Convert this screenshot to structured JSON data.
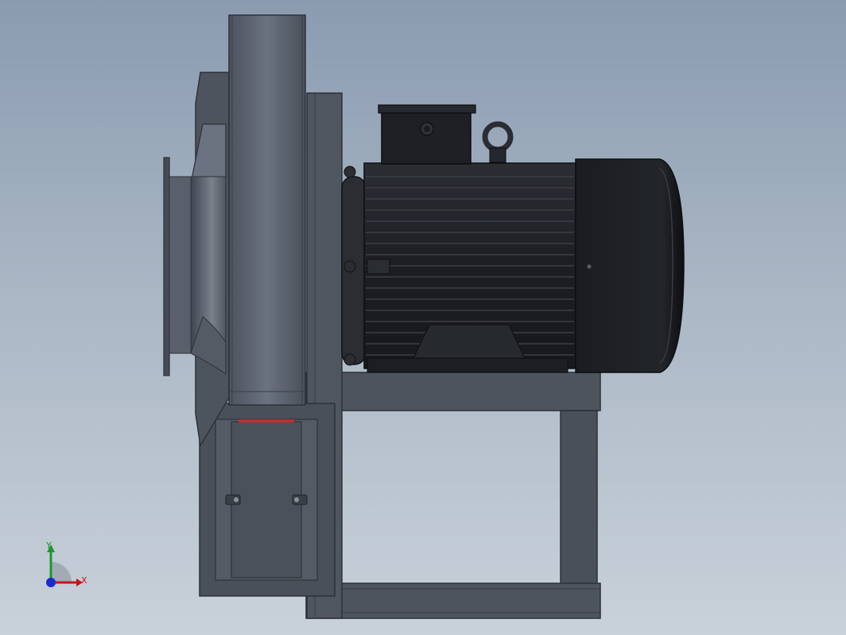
{
  "viewport": {
    "background_top": "#8a9bb0",
    "background_bottom": "#c9d1da"
  },
  "model": {
    "parts": [
      "fan-inlet-flange",
      "fan-volute-housing",
      "fan-outlet-duct",
      "motor-terminal-box",
      "lifting-eye-bolt",
      "motor-body",
      "motor-end-cap",
      "support-frame"
    ],
    "colors": {
      "housing": "#5c6370",
      "housing_dark": "#3f4550",
      "motor": "#1e2024",
      "frame": "#4a505a",
      "accent_red": "#b83030"
    }
  },
  "triad": {
    "y_label": "Y",
    "x_label": "X",
    "colors": {
      "x": "#c01818",
      "y": "#1a9a2a",
      "z": "#1a2ad0"
    }
  }
}
